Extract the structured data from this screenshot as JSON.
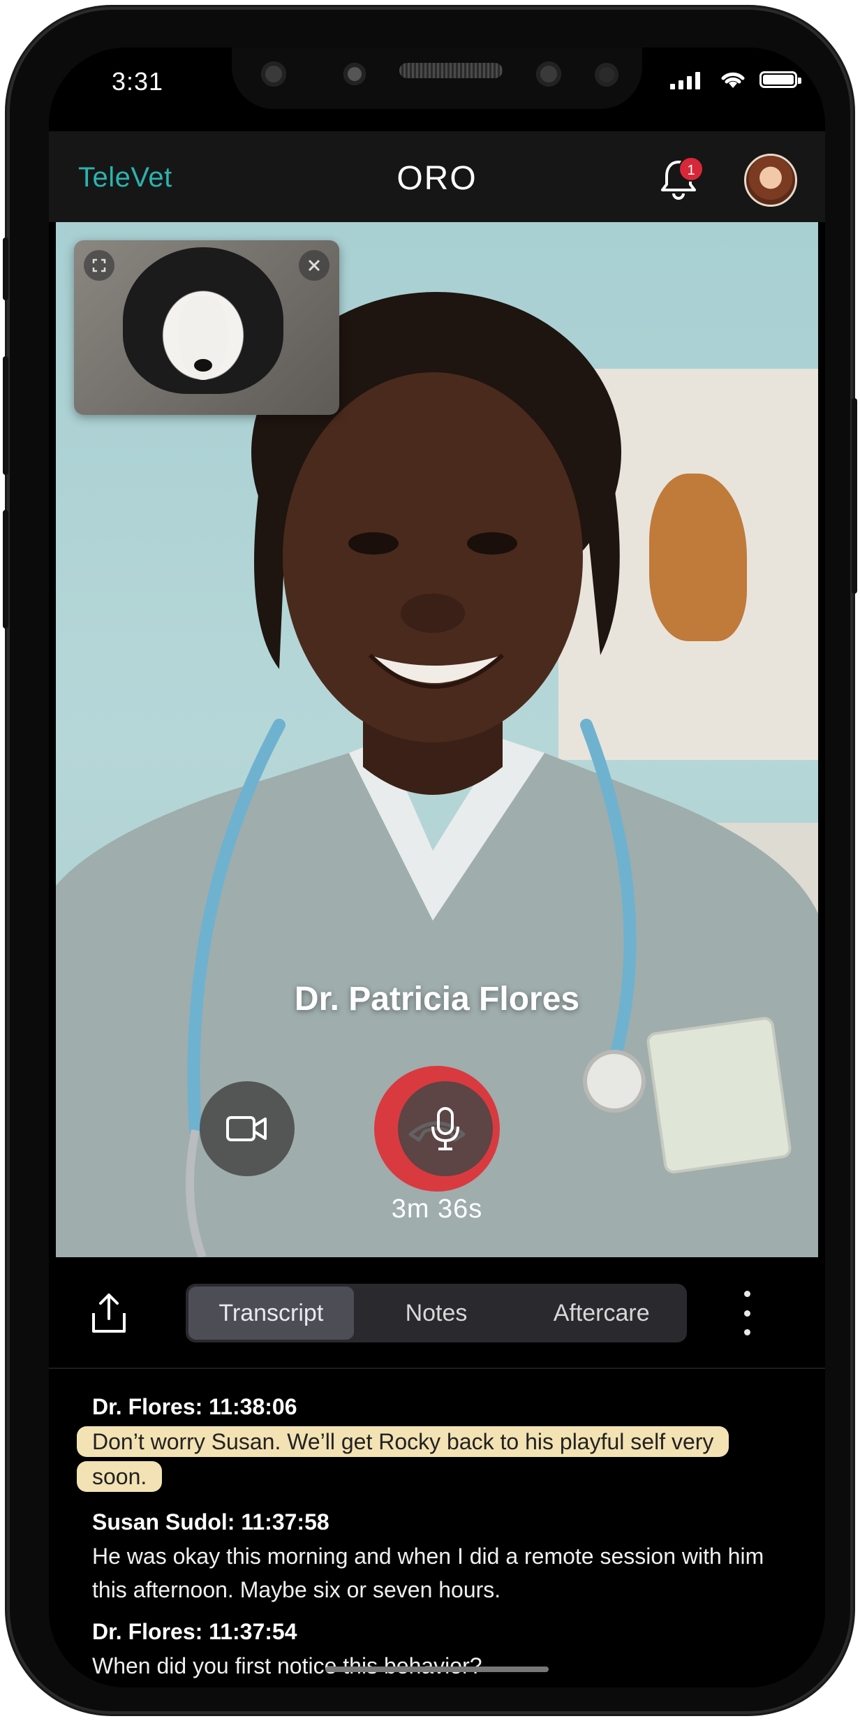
{
  "status_bar": {
    "time": "3:31"
  },
  "app_bar": {
    "brand": "TeleVet",
    "title": "ORO",
    "notification_count": "1"
  },
  "call": {
    "caller_name": "Dr. Patricia Flores",
    "duration": "3m 36s",
    "controls": [
      "video-camera-icon",
      "end-call-icon",
      "microphone-icon"
    ],
    "end_call_color": "#d93a3f"
  },
  "tabs": {
    "items": [
      {
        "label": "Transcript",
        "active": true
      },
      {
        "label": "Notes",
        "active": false
      },
      {
        "label": "Aftercare",
        "active": false
      }
    ]
  },
  "transcript": {
    "entries": [
      {
        "speaker": "Dr. Flores: 11:38:06",
        "text": "Don’t worry Susan. We’ll get Rocky back to his playful self very soon.",
        "highlighted": true
      },
      {
        "speaker": "Susan Sudol: 11:37:58",
        "text": "He was okay this morning and when I did a remote session with him this afternoon. Maybe six or seven hours.",
        "highlighted": false
      },
      {
        "speaker": "Dr. Flores: 11:37:54",
        "text": "When did you first notice this behavior?",
        "highlighted": false
      }
    ]
  },
  "colors": {
    "brand": "#2bb3b0",
    "highlight": "#f3e2b3",
    "badge": "#d7283a"
  }
}
